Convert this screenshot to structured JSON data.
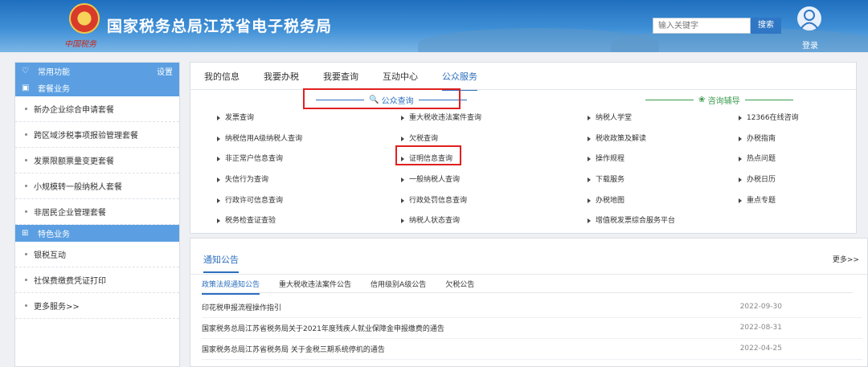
{
  "header": {
    "title": "国家税务总局江苏省电子税务局",
    "emblem_caption": "中国税务",
    "search_placeholder": "输入关键字",
    "search_button": "搜索",
    "login": "登录"
  },
  "sidebar": {
    "groups": [
      {
        "title": "常用功能",
        "action": "设置",
        "icon": "heart-icon",
        "items": []
      },
      {
        "title": "套餐业务",
        "icon": "calendar-icon",
        "items": [
          "新办企业综合申请套餐",
          "跨区域涉税事项报验管理套餐",
          "发票限额票量变更套餐",
          "小规模转一般纳税人套餐",
          "非居民企业管理套餐"
        ]
      },
      {
        "title": "特色业务",
        "icon": "grid-icon",
        "items": [
          "银税互动",
          "社保费缴费凭证打印",
          "更多服务>>"
        ]
      }
    ]
  },
  "main_tabs": [
    "我的信息",
    "我要办税",
    "我要查询",
    "互动中心",
    "公众服务"
  ],
  "active_tab": "公众服务",
  "public_query": {
    "title": "公众查询",
    "col1": [
      "发票查询",
      "纳税信用A级纳税人查询",
      "非正常户信息查询",
      "失信行为查询",
      "行政许可信息查询",
      "税务检查证查验"
    ],
    "col2": [
      "重大税收违法案件查询",
      "欠税查询",
      "证明信息查询",
      "一般纳税人查询",
      "行政处罚信息查询",
      "纳税人状态查询"
    ]
  },
  "consult": {
    "title": "咨询辅导",
    "col1": [
      "纳税人学堂",
      "税收政策及解读",
      "操作规程",
      "下载服务",
      "办税地图",
      "增值税发票综合服务平台"
    ],
    "col2": [
      "12366在线咨询",
      "办税指南",
      "热点问题",
      "办税日历",
      "重点专题"
    ]
  },
  "notice": {
    "title": "通知公告",
    "more": "更多>>",
    "subtabs": [
      "政策法规通知公告",
      "重大税收违法案件公告",
      "信用级别A级公告",
      "欠税公告"
    ],
    "rows": [
      {
        "text": "印花税申报流程操作指引",
        "date": "2022-09-30"
      },
      {
        "text": "国家税务总局江苏省税务局关于2021年度残疾人就业保障金申报缴费的通告",
        "date": "2022-08-31"
      },
      {
        "text": "国家税务总局江苏省税务局 关于金税三期系统停机的通告",
        "date": "2022-04-25"
      }
    ]
  }
}
